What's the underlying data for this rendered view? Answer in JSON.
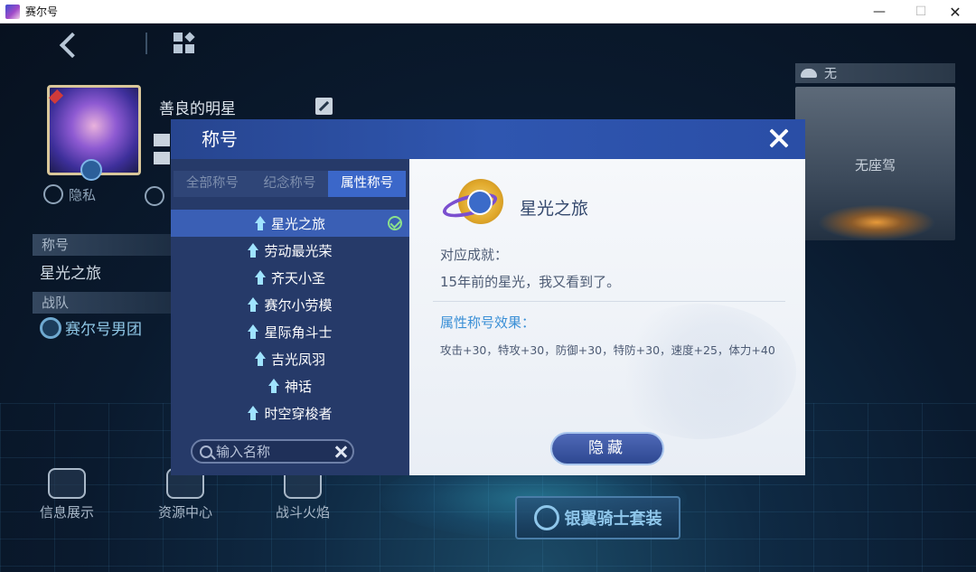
{
  "window": {
    "title": "赛尔号"
  },
  "profile": {
    "name": "善良的明星",
    "privacy_label": "隐私"
  },
  "sections": {
    "title_label": "称号",
    "title_value": "星光之旅",
    "team_label": "战队",
    "team_value": "赛尔号男团"
  },
  "bottom_buttons": [
    {
      "label": "信息展示"
    },
    {
      "label": "资源中心"
    },
    {
      "label": "战斗火焰"
    }
  ],
  "mount": {
    "header": "无",
    "empty_text": "无座驾"
  },
  "suit_button": {
    "label": "银翼骑士套装"
  },
  "modal": {
    "title": "称号",
    "tabs": [
      {
        "label": "全部称号",
        "active": false
      },
      {
        "label": "纪念称号",
        "active": false
      },
      {
        "label": "属性称号",
        "active": true
      }
    ],
    "items": [
      {
        "label": "星光之旅",
        "selected": true
      },
      {
        "label": "劳动最光荣",
        "selected": false
      },
      {
        "label": "齐天小圣",
        "selected": false
      },
      {
        "label": "赛尔小劳模",
        "selected": false
      },
      {
        "label": "星际角斗士",
        "selected": false
      },
      {
        "label": "吉光凤羽",
        "selected": false
      },
      {
        "label": "神话",
        "selected": false
      },
      {
        "label": "时空穿梭者",
        "selected": false
      }
    ],
    "search": {
      "placeholder": "输入名称",
      "value": ""
    },
    "detail": {
      "title": "星光之旅",
      "achievement_label": "对应成就：",
      "achievement_text": "15年前的星光，我又看到了。",
      "effect_label": "属性称号效果：",
      "effect_text": "攻击+30，特攻+30，防御+30，特防+30，速度+25，体力+40"
    },
    "hide_button": "隐藏"
  },
  "colors": {
    "accent": "#3b67c9",
    "modal_header": "#2f56b0",
    "effect_text": "#3a8fd6",
    "check": "#8be08b"
  }
}
